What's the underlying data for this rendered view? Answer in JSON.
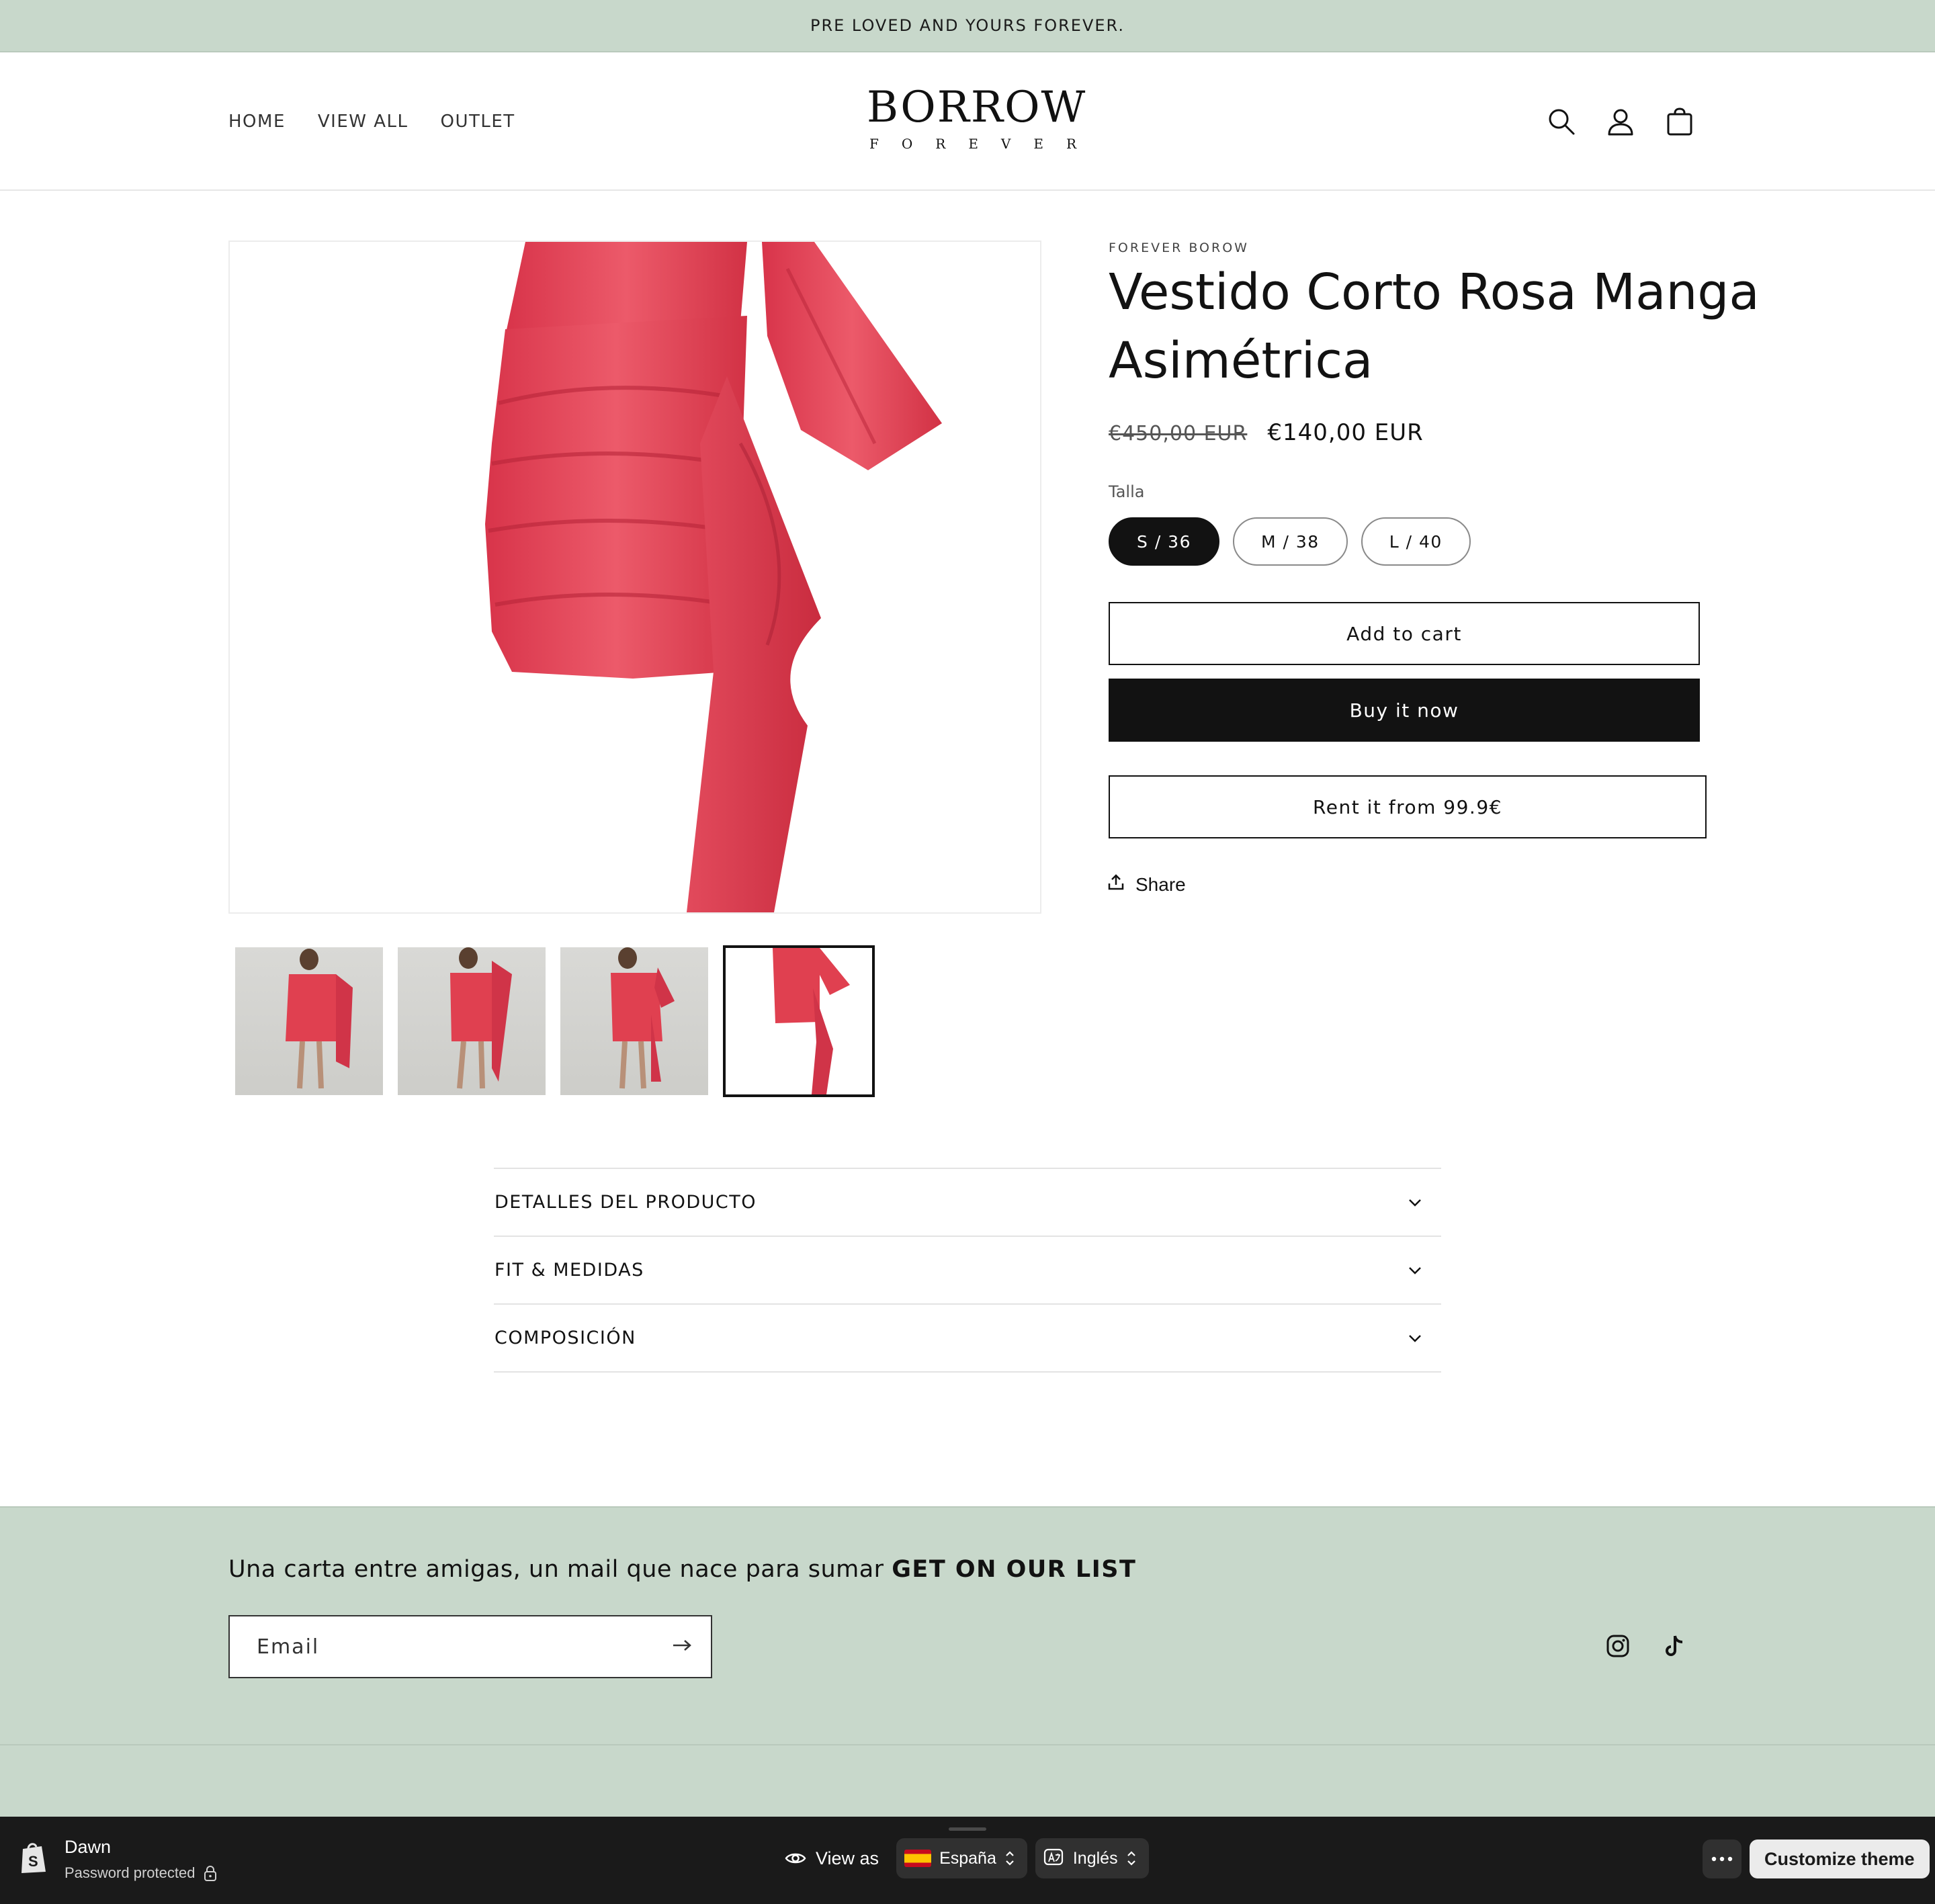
{
  "announcement": "PRE LOVED AND YOURS FOREVER.",
  "nav": {
    "items": [
      "HOME",
      "VIEW ALL",
      "OUTLET"
    ]
  },
  "logo": {
    "line1": "BORROW",
    "line2": "FOREVER"
  },
  "header_icons": [
    "search-icon",
    "account-icon",
    "cart-icon"
  ],
  "product": {
    "vendor": "FOREVER BOROW",
    "title": "Vestido Corto Rosa Manga Asimétrica",
    "price_compare": "€450,00 EUR",
    "price": "€140,00 EUR",
    "option_label": "Talla",
    "sizes": [
      "S / 36",
      "M / 38",
      "L / 40"
    ],
    "selected_size": "S / 36",
    "add_to_cart": "Add to cart",
    "buy_now": "Buy it now",
    "rent": "Rent it from 99.9€",
    "share": "Share",
    "dress_color": "#e0404f"
  },
  "accordion": [
    "DETALLES DEL PRODUCTO",
    "FIT & MEDIDAS",
    "COMPOSICIÓN"
  ],
  "footer": {
    "newsletter_text": "Una carta entre amigas, un mail que nace para sumar ",
    "newsletter_bold": "GET ON OUR LIST",
    "email_placeholder": "Email",
    "socials": [
      "instagram-icon",
      "tiktok-icon"
    ],
    "background": "#c8d8cb"
  },
  "admin_bar": {
    "theme": "Dawn",
    "status": "Password protected",
    "view_as": "View as",
    "country": "España",
    "language": "Inglés",
    "customize": "Customize theme"
  }
}
